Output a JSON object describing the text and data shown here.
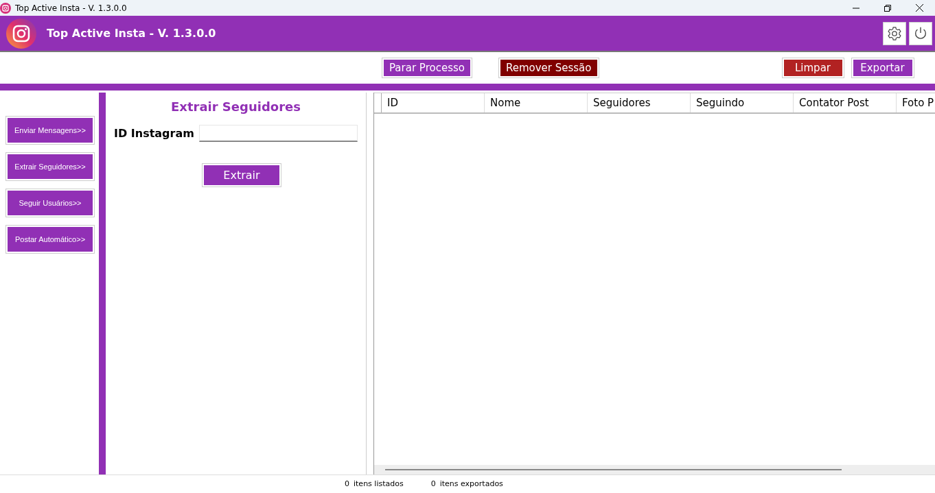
{
  "window": {
    "title": "Top Active Insta - V. 1.3.0.0"
  },
  "header": {
    "title": "Top Active Insta - V. 1.3.0.0"
  },
  "toolbar": [
    {
      "label": "Parar Processo",
      "kind": "primary"
    },
    {
      "label": "Remover Sessão",
      "kind": "dark"
    },
    {
      "label": "Limpar",
      "kind": "danger"
    },
    {
      "label": "Exportar",
      "kind": "primary"
    }
  ],
  "sidebar": {
    "items": [
      {
        "label": "Enviar Mensagens>>"
      },
      {
        "label": "Extrair Seguidores>>"
      },
      {
        "label": "Seguir Usuários>>"
      },
      {
        "label": "Postar Automático>>"
      }
    ]
  },
  "form": {
    "title": "Extrair Seguidores",
    "field_label": "ID Instagram",
    "button": "Extrair"
  },
  "table": {
    "columns": [
      "ID",
      "Nome",
      "Seguidores",
      "Seguindo",
      "Contator Post",
      "Foto P"
    ]
  },
  "status_bar": [
    {
      "count": "0",
      "label": "itens listados"
    },
    {
      "count": "0",
      "label": "itens exportados"
    }
  ]
}
